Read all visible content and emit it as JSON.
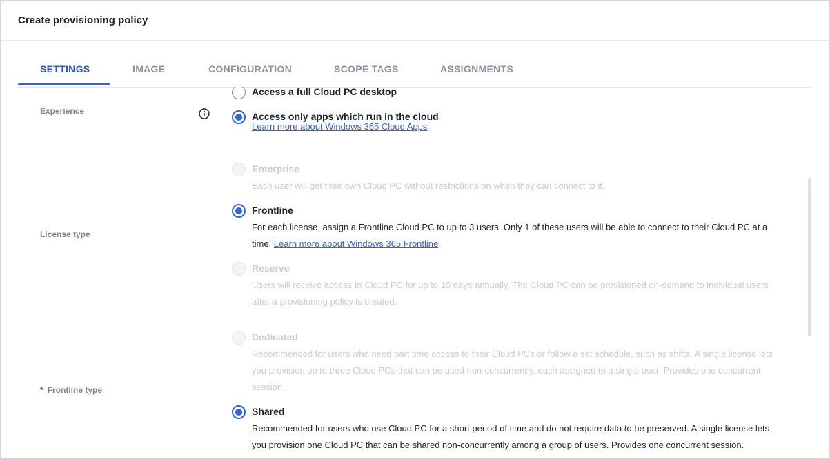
{
  "header": {
    "title": "Create provisioning policy"
  },
  "tabs": [
    {
      "label": "SETTINGS",
      "active": true
    },
    {
      "label": "IMAGE"
    },
    {
      "label": "CONFIGURATION"
    },
    {
      "label": "SCOPE TAGS"
    },
    {
      "label": "ASSIGNMENTS"
    }
  ],
  "fields": {
    "experience": {
      "label": "Experience",
      "options": [
        {
          "label": "Access a full Cloud PC desktop",
          "selected": false
        },
        {
          "label": "Access only apps which run in the cloud",
          "selected": true,
          "link": "Learn more about Windows 365 Cloud Apps"
        }
      ]
    },
    "license_type": {
      "label": "License type",
      "options": [
        {
          "label": "Enterprise",
          "disabled": true,
          "desc": "Each user will get their own Cloud PC without restrictions on when they can connect to it."
        },
        {
          "label": "Frontline",
          "selected": true,
          "desc": "For each license, assign a Frontline Cloud PC to up to 3 users. Only 1 of these users will be able to connect to their Cloud PC at a time.",
          "link": "Learn more about Windows 365 Frontline"
        },
        {
          "label": "Reserve",
          "disabled": true,
          "desc": "Users will receive access to Cloud PC for up to 10 days annually. The Cloud PC can be provisioned on-demand to individual users after a provisioning policy is created."
        }
      ]
    },
    "frontline_type": {
      "label": "Frontline type",
      "required_marker": "*",
      "options": [
        {
          "label": "Dedicated",
          "disabled": true,
          "desc": "Recommended for users who need part time access to their Cloud PCs or follow a set schedule, such as shifts. A single license lets you provision up to three Cloud PCs that can be used non-concurrently, each assigned to a single user. Provides one concurrent session."
        },
        {
          "label": "Shared",
          "selected": true,
          "desc": "Recommended for users who use Cloud PC for a short period of time and do not require data to be preserved. A single license lets you provision one Cloud PC that can be shared non-concurrently among a group of users. Provides one concurrent session."
        }
      ]
    }
  },
  "colors": {
    "accent": "#2f62e6",
    "disabled_text": "#c7ccd4",
    "label_grey": "#7d8594"
  }
}
